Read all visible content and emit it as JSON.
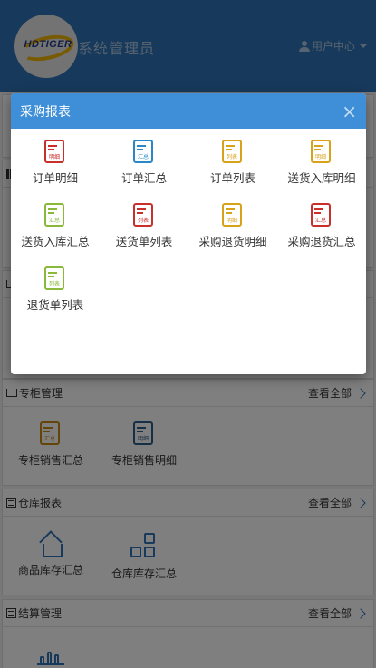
{
  "header": {
    "logo_text": "HDTIGER",
    "title": "系统管理员",
    "user_center": "用户中心"
  },
  "sections": [
    {
      "title": "专柜管理",
      "view_all": "查看全部",
      "items": [
        {
          "label": "专柜销售汇总",
          "tag": "汇总",
          "color": "orange"
        },
        {
          "label": "专柜销售明细",
          "tag": "明细",
          "color": "navy"
        }
      ]
    },
    {
      "title": "仓库报表",
      "view_all": "查看全部",
      "items": [
        {
          "label": "商品库存汇总",
          "icon": "warehouse-icon"
        },
        {
          "label": "仓库库存汇总",
          "icon": "blocks-icon"
        }
      ]
    },
    {
      "title": "结算管理",
      "view_all": "查看全部",
      "items": [
        {
          "label": "",
          "icon": "trend-chart-icon"
        }
      ]
    }
  ],
  "modal": {
    "title": "采购报表",
    "close": "×",
    "items": [
      {
        "label": "订单明细",
        "tag": "明细",
        "color": "red"
      },
      {
        "label": "订单汇总",
        "tag": "汇总",
        "color": "blue"
      },
      {
        "label": "订单列表",
        "tag": "列表",
        "color": "yellow"
      },
      {
        "label": "送货入库明细",
        "tag": "明细",
        "color": "yellow"
      },
      {
        "label": "送货入库汇总",
        "tag": "汇总",
        "color": "green"
      },
      {
        "label": "送货单列表",
        "tag": "列表",
        "color": "red"
      },
      {
        "label": "采购退货明细",
        "tag": "明细",
        "color": "yellow"
      },
      {
        "label": "采购退货汇总",
        "tag": "汇总",
        "color": "red"
      },
      {
        "label": "退货单列表",
        "tag": "列表",
        "color": "green"
      }
    ]
  },
  "colors": {
    "header_bg": "#2f72b6",
    "modal_header_bg": "#3f8fd8",
    "red": "#c9302c",
    "blue": "#2a88c7",
    "yellow": "#d9a21b",
    "green": "#8ab93a",
    "orange": "#c98a12",
    "navy": "#2f5f8a"
  }
}
